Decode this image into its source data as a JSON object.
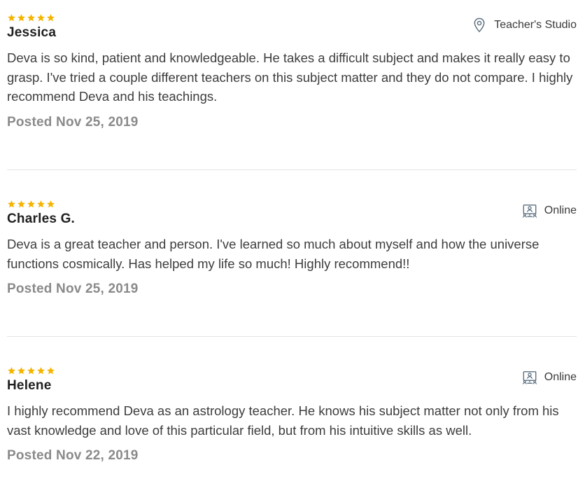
{
  "colors": {
    "star": "#f5b400",
    "icon": "#5b6f80",
    "divider": "#e4e4e4"
  },
  "reviews": [
    {
      "rating": 5,
      "name": "Jessica",
      "location": {
        "icon": "map-pin-icon",
        "label": "Teacher's Studio"
      },
      "text": "Deva is so kind, patient and knowledgeable. He takes a difficult subject and makes it really easy to grasp. I've tried a couple different teachers on this subject matter and they do not compare. I highly recommend Deva and his teachings.",
      "date": "Posted Nov 25, 2019"
    },
    {
      "rating": 5,
      "name": "Charles G.",
      "location": {
        "icon": "online-class-icon",
        "label": "Online"
      },
      "text": "Deva is a great teacher and person. I've learned so much about myself and how the universe functions cosmically. Has helped my life so much! Highly recommend!!",
      "date": "Posted Nov 25, 2019"
    },
    {
      "rating": 5,
      "name": "Helene",
      "location": {
        "icon": "online-class-icon",
        "label": "Online"
      },
      "text": "I highly recommend Deva as an astrology teacher. He knows his subject matter not only from his vast knowledge and love of this particular field, but from his intuitive skills as well.",
      "date": "Posted Nov 22, 2019"
    }
  ]
}
